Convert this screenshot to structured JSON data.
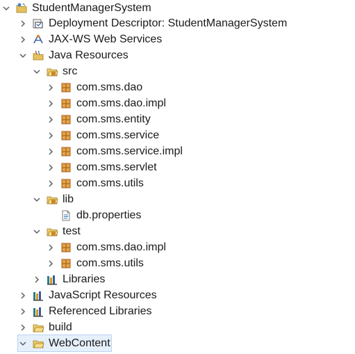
{
  "tree": {
    "project": {
      "label": "StudentManagerSystem",
      "icon": "project-folder-icon",
      "expanded": true
    },
    "nodes": [
      {
        "label": "Deployment Descriptor: StudentManagerSystem",
        "icon": "deployment-descriptor-icon",
        "expanded": false
      },
      {
        "label": "JAX-WS Web Services",
        "icon": "web-services-icon",
        "expanded": false
      },
      {
        "label": "Java Resources",
        "icon": "java-resources-icon",
        "expanded": true
      },
      {
        "label": "src",
        "icon": "source-folder-icon",
        "expanded": true
      },
      {
        "label": "com.sms.dao",
        "icon": "package-icon",
        "expanded": false
      },
      {
        "label": "com.sms.dao.impl",
        "icon": "package-icon",
        "expanded": false
      },
      {
        "label": "com.sms.entity",
        "icon": "package-icon",
        "expanded": false
      },
      {
        "label": "com.sms.service",
        "icon": "package-icon",
        "expanded": false
      },
      {
        "label": "com.sms.service.impl",
        "icon": "package-icon",
        "expanded": false
      },
      {
        "label": "com.sms.servlet",
        "icon": "package-icon",
        "expanded": false
      },
      {
        "label": "com.sms.utils",
        "icon": "package-icon",
        "expanded": false
      },
      {
        "label": "lib",
        "icon": "source-folder-icon",
        "expanded": true
      },
      {
        "label": "db.properties",
        "icon": "file-icon",
        "expanded": false
      },
      {
        "label": "test",
        "icon": "source-folder-icon",
        "expanded": true
      },
      {
        "label": "com.sms.dao.impl",
        "icon": "package-icon",
        "expanded": false
      },
      {
        "label": "com.sms.utils",
        "icon": "package-icon",
        "expanded": false
      },
      {
        "label": "Libraries",
        "icon": "libraries-icon",
        "expanded": false
      },
      {
        "label": "JavaScript Resources",
        "icon": "javascript-resources-icon",
        "expanded": false
      },
      {
        "label": "Referenced Libraries",
        "icon": "referenced-libraries-icon",
        "expanded": false
      },
      {
        "label": "build",
        "icon": "folder-icon",
        "expanded": false
      },
      {
        "label": "WebContent",
        "icon": "open-folder-icon",
        "expanded": true,
        "selected": true
      }
    ]
  },
  "colors": {
    "chevron": "#5d5d5d",
    "package_orange": "#c9862e",
    "folder_yellow": "#e8c15d",
    "library_teal": "#2c7c87",
    "selection_bg": "#e6f0fb"
  }
}
